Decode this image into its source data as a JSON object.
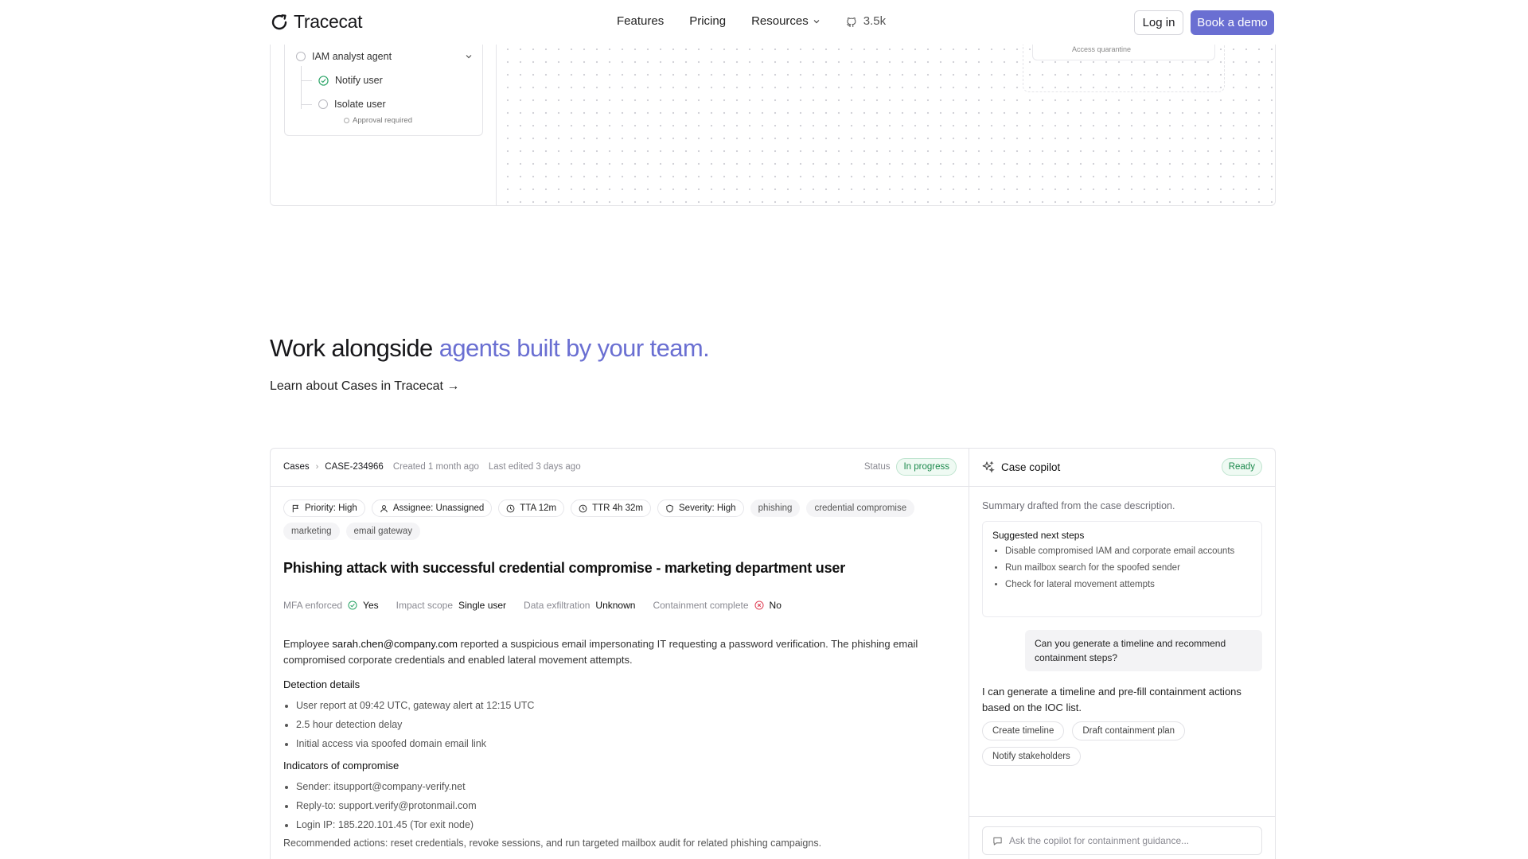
{
  "nav": {
    "brand": "Tracecat",
    "links": [
      "Features",
      "Pricing",
      "Resources"
    ],
    "github_stars": "3.5k",
    "login": "Log in",
    "demo": "Book a demo",
    "accent_color": "#6a6fd2"
  },
  "workflow": {
    "agent": "IAM analyst agent",
    "tasks": [
      "Notify user",
      "Isolate user"
    ],
    "approval": "Approval required",
    "canvas_node_label": "Access quarantine"
  },
  "section": {
    "headline_plain": "Work alongside ",
    "headline_accent": "agents built by your team.",
    "learn_link": "Learn about Cases in Tracecat →"
  },
  "case": {
    "breadcrumb_root": "Cases",
    "case_id": "CASE-234966",
    "created": "Created 1 month ago",
    "edited": "Last edited 3 days ago",
    "status_label": "Status",
    "status_value": "In progress",
    "chips": [
      {
        "label": "Priority: High",
        "icon": "flag-icon"
      },
      {
        "label": "Assignee: Unassigned",
        "icon": "user-icon"
      },
      {
        "label": "TTA 12m",
        "icon": "clock-icon"
      },
      {
        "label": "TTR 4h 32m",
        "icon": "clock-icon"
      },
      {
        "label": "Severity: High",
        "icon": "shield-icon"
      }
    ],
    "tags": [
      "phishing",
      "credential compromise",
      "marketing",
      "email gateway"
    ],
    "title": "Phishing attack with successful credential compromise - marketing department user",
    "facts": {
      "mfa_label": "MFA enforced",
      "mfa_value": "Yes",
      "impact_label": "Impact scope",
      "impact_value": "Single user",
      "exfil_label": "Data exfiltration",
      "exfil_value": "Unknown",
      "contain_label": "Containment complete",
      "contain_value": "No"
    },
    "desc_prefix": "Employee ",
    "desc_email": "sarah.chen@company.com",
    "desc_suffix": " reported a suspicious email impersonating IT requesting a password verification. The phishing email compromised corporate credentials and enabled lateral movement attempts.",
    "detection_heading": "Detection details",
    "detection_items": [
      "User report at 09:42 UTC, gateway alert at 12:15 UTC",
      "2.5 hour detection delay",
      "Initial access via spoofed domain email link"
    ],
    "ioc_heading": "Indicators of compromise",
    "ioc_items": [
      "Sender: itsupport@company-verify.net",
      "Reply-to: support.verify@protonmail.com",
      "Login IP: 185.220.101.45 (Tor exit node)"
    ],
    "recommended": "Recommended actions: reset credentials, revoke sessions, and run targeted mailbox audit for related phishing campaigns."
  },
  "copilot": {
    "title": "Case copilot",
    "status": "Ready",
    "summary": "Summary drafted from the case description.",
    "steps_heading": "Suggested next steps",
    "steps": [
      "Disable compromised IAM and corporate email accounts",
      "Run mailbox search for the spoofed sender",
      "Check for lateral movement attempts"
    ],
    "user_message": "Can you generate a timeline and recommend containment steps?",
    "bot_message": "I can generate a timeline and pre-fill containment actions based on the IOC list.",
    "suggestions": [
      "Create timeline",
      "Draft containment plan",
      "Notify stakeholders"
    ],
    "input_placeholder": "Ask the copilot for containment guidance..."
  }
}
